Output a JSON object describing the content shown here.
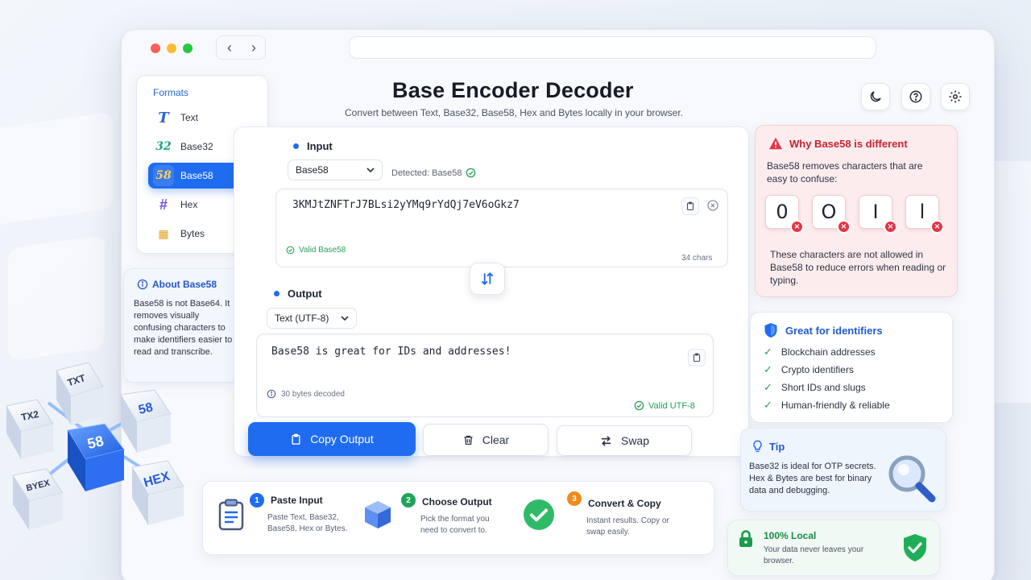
{
  "app": {
    "title": "Base Encoder Decoder",
    "subtitle": "Convert between Text, Base32, Base58, Hex and Bytes locally in your browser."
  },
  "header_icons": [
    "moon-icon",
    "help-icon",
    "gear-icon"
  ],
  "formats": {
    "title": "Formats",
    "items": [
      {
        "label": "Text",
        "glyph": "T",
        "active": false
      },
      {
        "label": "Base32",
        "glyph": "32",
        "active": false
      },
      {
        "label": "Base58",
        "glyph": "58",
        "active": true
      },
      {
        "label": "Hex",
        "glyph": "#",
        "active": false
      },
      {
        "label": "Bytes",
        "glyph": "▦",
        "active": false
      }
    ]
  },
  "about": {
    "title": "About Base58",
    "body": "Base58 is not Base64. It removes visually confusing characters to make identifiers easier to read and transcribe."
  },
  "input": {
    "label": "Input",
    "format": "Base58",
    "detected": "Detected: Base58",
    "value": "3KMJtZNFTrJ7BLsi2yYMq9rYdQj7eV6oGkz7",
    "valid": "Valid Base58",
    "count": "34 chars"
  },
  "output": {
    "label": "Output",
    "format": "Text (UTF-8)",
    "value": "Base58 is great for IDs and addresses!",
    "meta": "30 bytes decoded",
    "valid": "Valid UTF-8"
  },
  "actions": {
    "copy": "Copy Output",
    "clear": "Clear",
    "swap": "Swap"
  },
  "steps": [
    {
      "num": "1",
      "title": "Paste Input",
      "desc": "Paste Text, Base32, Base58, Hex or Bytes.",
      "color": "#1f6cf0"
    },
    {
      "num": "2",
      "title": "Choose Output",
      "desc": "Pick the format you need to convert to.",
      "color": "#22a35a"
    },
    {
      "num": "3",
      "title": "Convert & Copy",
      "desc": "Instant results. Copy or swap easily.",
      "color": "#f08a1c"
    }
  ],
  "why": {
    "title": "Why Base58 is different",
    "body": "Base58 removes characters that are easy to confuse:",
    "chars": [
      "0",
      "O",
      "I",
      "l"
    ],
    "foot": "These characters are not allowed in Base58 to reduce errors when reading or typing."
  },
  "great": {
    "title": "Great for identifiers",
    "items": [
      "Blockchain addresses",
      "Crypto identifiers",
      "Short IDs and slugs",
      "Human-friendly & reliable"
    ]
  },
  "tip": {
    "title": "Tip",
    "body": "Base32 is ideal for OTP secrets. Hex & Bytes are best for binary data and debugging."
  },
  "local": {
    "title": "100% Local",
    "body": "Your data never leaves your browser."
  },
  "cubes": [
    "TXT",
    "TX2",
    "58",
    "58",
    "BYEX",
    "HEX"
  ],
  "colors": {
    "accent": "#1f6cf0",
    "success": "#22a35a",
    "danger": "#e33545",
    "warning": "#f08a1c"
  }
}
